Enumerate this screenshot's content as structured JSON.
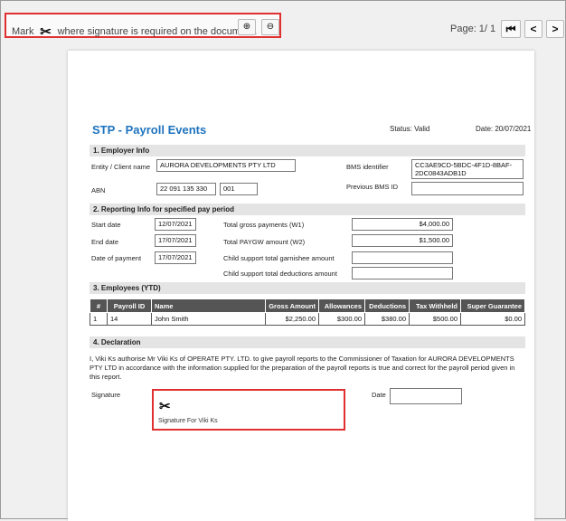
{
  "toolbar": {
    "mark_prefix": "Mark",
    "mark_suffix": "where signature is required on the document.",
    "zoom_in_symbol": "⊕",
    "zoom_out_symbol": "⊖",
    "page_label": "Page: 1/ 1",
    "first_symbol": "⏮",
    "prev_symbol": "<",
    "next_symbol": ">"
  },
  "doc": {
    "title": "STP - Payroll Events",
    "status": "Status:  Valid",
    "date": "Date:  20/07/2021",
    "employer": {
      "header": "1. Employer Info",
      "client_label": "Entity / Client name",
      "client_value": "AURORA DEVELOPMENTS PTY LTD",
      "bms_label": "BMS identifier",
      "bms_value": "CC3AE9CD-5BDC-4F1D-8BAF-2DC0843ADB1D",
      "abn_label": "ABN",
      "abn_value": "22 091 135 330",
      "branch_value": "001",
      "prev_bms_label": "Previous BMS ID",
      "prev_bms_value": ""
    },
    "reporting": {
      "header": "2. Reporting Info for specified pay period",
      "start_label": "Start date",
      "start_value": "12/07/2021",
      "end_label": "End date",
      "end_value": "17/07/2021",
      "payment_label": "Date of payment",
      "payment_value": "17/07/2021",
      "gross_label": "Total gross payments (W1)",
      "gross_value": "$4,000.00",
      "paygw_label": "Total PAYGW amount (W2)",
      "paygw_value": "$1,500.00",
      "garnishee_label": "Child support total garnishee amount",
      "garnishee_value": "",
      "deductions_label": "Child support total deductions amount",
      "deductions_value": ""
    },
    "employees": {
      "header": "3. Employees (YTD)",
      "columns": [
        "#",
        "Payroll ID",
        "Name",
        "Gross Amount",
        "Allowances",
        "Deductions",
        "Tax Withheld",
        "Super Guarantee"
      ],
      "rows": [
        [
          "1",
          "14",
          "John Smith",
          "$2,250.00",
          "$300.00",
          "$380.00",
          "$500.00",
          "$0.00"
        ]
      ]
    },
    "declaration": {
      "header": "4. Declaration",
      "text": "I, Viki Ks authorise Mr Viki Ks of OPERATE PTY. LTD. to give payroll reports to the Commissioner of Taxation for AURORA DEVELOPMENTS PTY LTD in accordance with the information supplied for the preparation of the payroll reports is true and correct  for the payroll period given in this report.",
      "signature_label": "Signature",
      "signature_text": "Signature For Viki Ks",
      "date_label": "Date",
      "date_value": ""
    }
  }
}
